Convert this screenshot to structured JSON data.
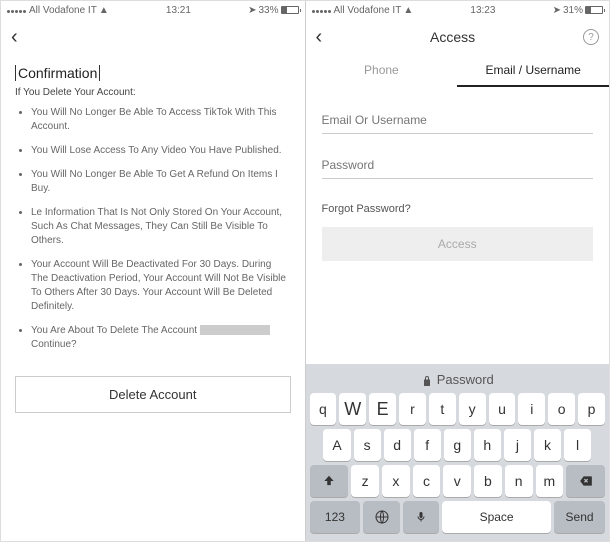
{
  "left": {
    "status": {
      "carrier": "All Vodafone IT",
      "time": "13:21",
      "battery": "33%"
    },
    "title": "Confirmation",
    "subtitle": "If You Delete Your Account:",
    "bullets": [
      "You Will No Longer Be Able To Access TikTok With This Account.",
      "You Will Lose Access To Any Video You Have Published.",
      "You Will No Longer Be Able To Get A Refund On Items I Buy.",
      "Le Information That Is Not Only Stored On Your Account, Such As Chat Messages, They Can Still Be Visible To Others.",
      "Your Account Will Be Deactivated For 30 Days. During The Deactivation Period, Your Account Will Not Be Visible To Others After 30 Days. Your Account Will Be Deleted Definitely.",
      "You Are About To Delete The Account"
    ],
    "continue_q": "Continue?",
    "delete_btn": "Delete Account"
  },
  "right": {
    "status": {
      "carrier": "All Vodafone IT",
      "time": "13:23",
      "battery": "31%"
    },
    "header": "Access",
    "tabs": {
      "phone": "Phone",
      "email": "Email / Username"
    },
    "email_ph": "Email Or Username",
    "pass_ph": "Password",
    "forgot": "Forgot Password?",
    "access_btn": "Access",
    "kb": {
      "suggest": "Password",
      "row1": [
        "q",
        "W",
        "E",
        "r",
        "t",
        "y",
        "u",
        "i",
        "o",
        "p"
      ],
      "row2": [
        "A",
        "s",
        "d",
        "f",
        "g",
        "h",
        "j",
        "k",
        "l"
      ],
      "row3": [
        "z",
        "x",
        "c",
        "v",
        "b",
        "n",
        "m"
      ],
      "n123": "123",
      "space": "Space",
      "send": "Send"
    }
  }
}
